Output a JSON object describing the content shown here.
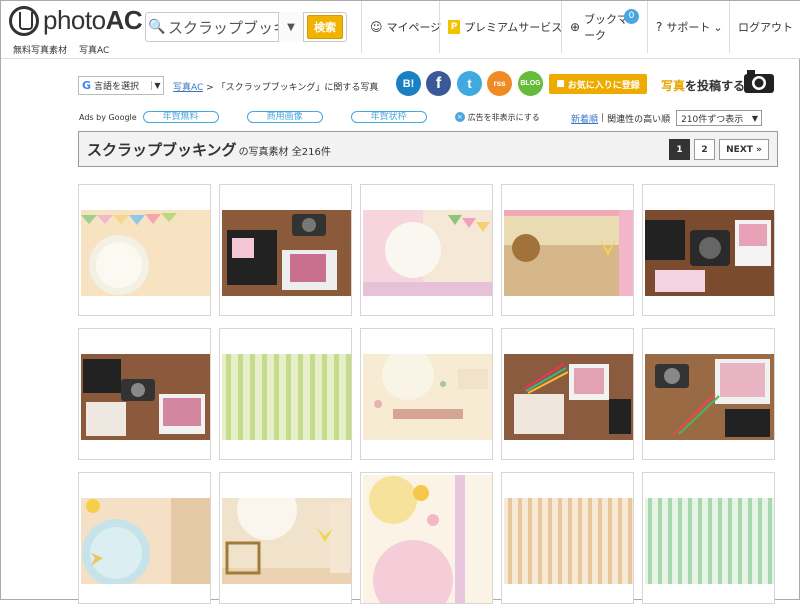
{
  "header": {
    "logo_text_a": "photo",
    "logo_text_b": "AC",
    "logo_sub_1": "無料写真素材",
    "logo_sub_2": "写真AC",
    "search_value": "スクラップブッキン",
    "search_button": "検索",
    "nav": {
      "mypage": "マイページ",
      "premium": "プレミアムサービス",
      "bookmark": "ブックマーク",
      "bookmark_count": "0",
      "support": "サポート",
      "logout": "ログアウト"
    }
  },
  "toolbar": {
    "language": "言語を選択",
    "breadcrumb_home": "写真AC",
    "breadcrumb_sep": ">",
    "breadcrumb_current": "「スクラップブッキング」に関する写真",
    "social": {
      "hatena": "B!",
      "facebook": "f",
      "twitter": "t",
      "rss": "rss",
      "blog": "BLOG"
    },
    "favorite_button": "お気に入りに登録",
    "post_prefix": "写真",
    "post_suffix": "を投稿する"
  },
  "ads": {
    "label": "Ads by Google",
    "pills": [
      "年賀無料",
      "商用画像",
      "年賀状枠"
    ],
    "hide": "広告を非表示にする"
  },
  "sort": {
    "newest": "新着順",
    "separator": "|",
    "relevance": "関連性の高い順",
    "per_page": "210件ずつ表示"
  },
  "results": {
    "keyword": "スクラップブッキング",
    "suffix": "の写真素材 全216件"
  },
  "pager": {
    "pages": [
      "1",
      "2"
    ],
    "next": "NEXT »"
  },
  "colors": {
    "accent_yellow": "#f0b400",
    "link_blue": "#3a76c6",
    "hatena": "#1a7fc3",
    "facebook": "#3b5998",
    "twitter": "#3fa9e0",
    "rss": "#f08a24",
    "blog": "#66bb3a"
  },
  "grid_icons": [
    "photo-thumb"
  ]
}
